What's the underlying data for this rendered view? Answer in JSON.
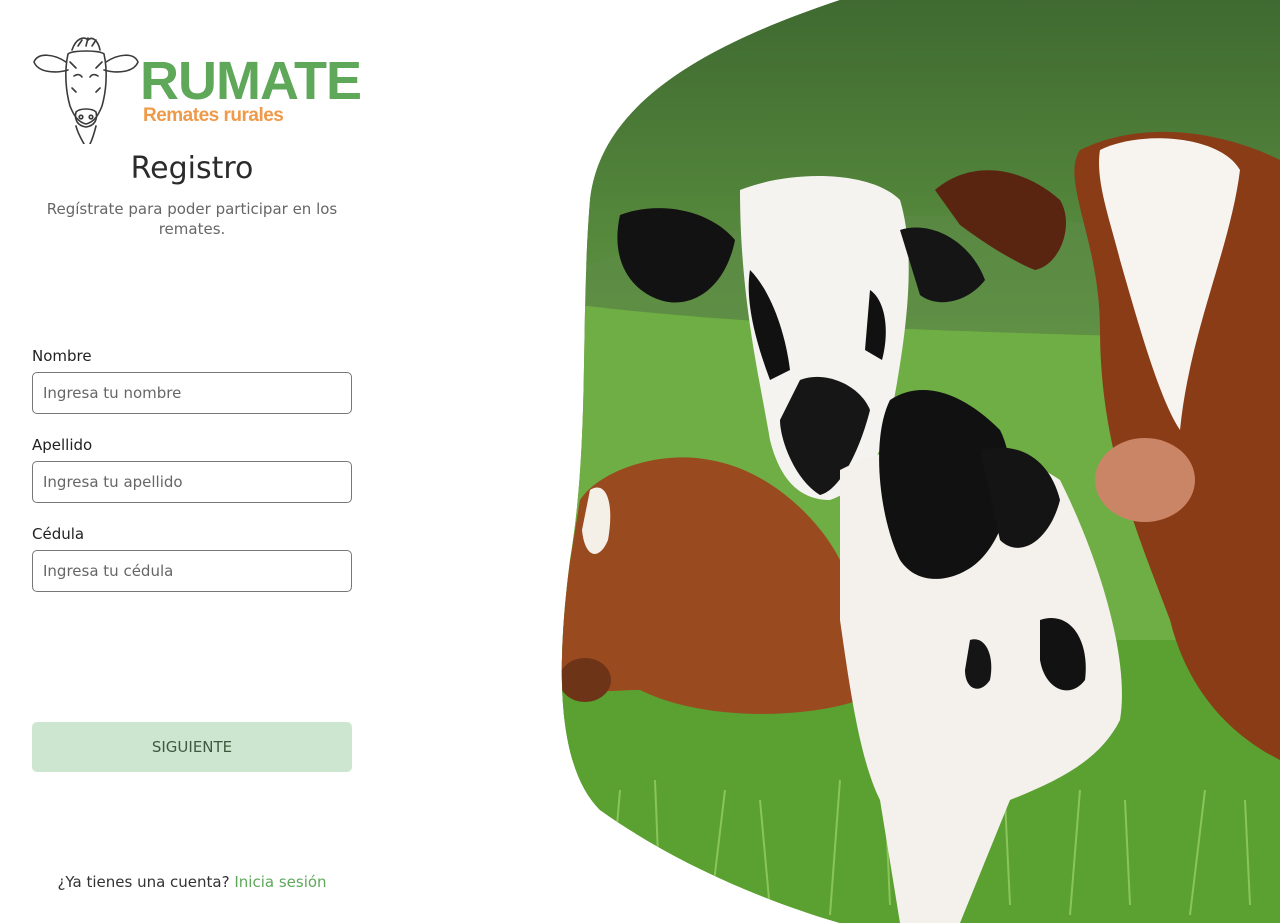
{
  "logo": {
    "brand": "RUMATE",
    "tagline": "Remates rurales",
    "brand_color": "#5fa85a",
    "tagline_color": "#ef9a4a",
    "icon": "cow-head-icon"
  },
  "header": {
    "title": "Registro",
    "subtitle": "Regístrate para poder participar en los remates."
  },
  "form": {
    "fields": [
      {
        "label": "Nombre",
        "placeholder": "Ingresa tu nombre",
        "value": ""
      },
      {
        "label": "Apellido",
        "placeholder": "Ingresa tu apellido",
        "value": ""
      },
      {
        "label": "Cédula",
        "placeholder": "Ingresa tu cédula",
        "value": ""
      }
    ],
    "submit_label": "SIGUIENTE",
    "submit_color": "#cce6cf"
  },
  "footer": {
    "prompt": "¿Ya tienes una cuenta?",
    "link_label": "Inicia sesión"
  },
  "hero": {
    "icon": "cows-in-pasture-photo"
  }
}
